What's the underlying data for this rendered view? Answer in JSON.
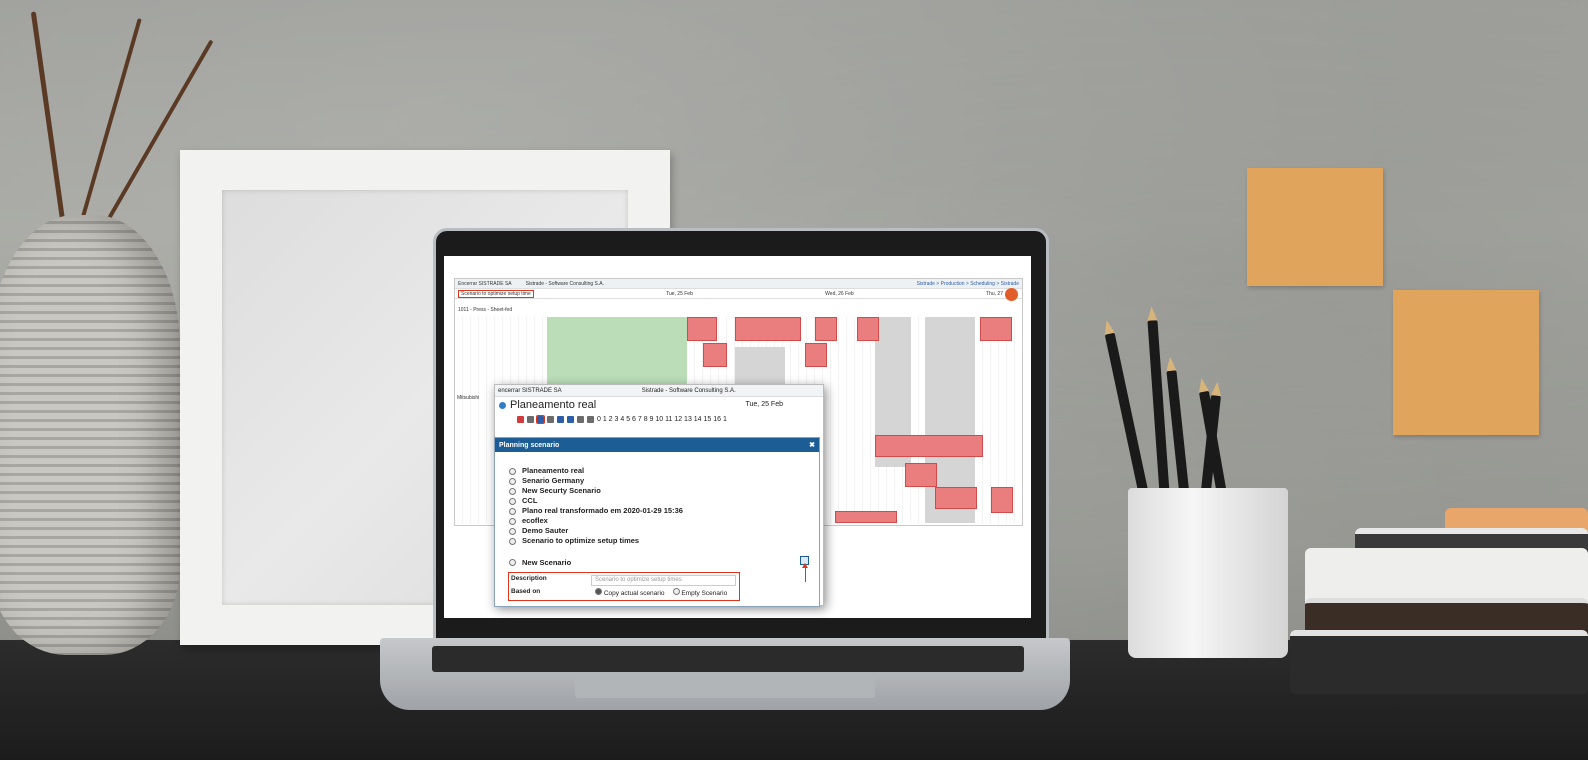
{
  "app": {
    "window_title": "Encerrar SISTRADE SA",
    "company": "Sistrade - Software Consulting S.A.",
    "breadcrumb": "Sistrade > Production > Scheduling > Sistrade",
    "scenario_label": "Scenario to optimize setup time",
    "dates": [
      "Tue, 25 Feb",
      "Wed, 26 Feb",
      "Thu, 27"
    ],
    "resource_row": "1011 - Press - Sheet-fed",
    "side_label": "Mitsubishi"
  },
  "overlay": {
    "window_title": "encerrar SISTRADE SA",
    "company": "Sistrade - Software Consulting S.A.",
    "plan_title": "Planeamento real",
    "date": "Tue, 25 Feb",
    "hours": "0 1 2 3 4 5 6 7 8 9 10 11 12 13 14 15 16 1"
  },
  "dialog": {
    "title": "Planning scenario",
    "close": "✖",
    "scenarios": [
      "Planeamento real",
      "Senario Germany",
      "New Securty Scenario",
      "CCL",
      "Plano real transformado em 2020-01-29 15:36",
      "ecoflex",
      "Demo Sauter",
      "Scenario to optimize setup times"
    ],
    "new_scenario": "New Scenario",
    "description_label": "Description",
    "description_placeholder": "Scenario to optimize setup times",
    "based_on_label": "Based on",
    "option_copy": "Copy actual scenario",
    "option_empty": "Empty Scenario"
  }
}
